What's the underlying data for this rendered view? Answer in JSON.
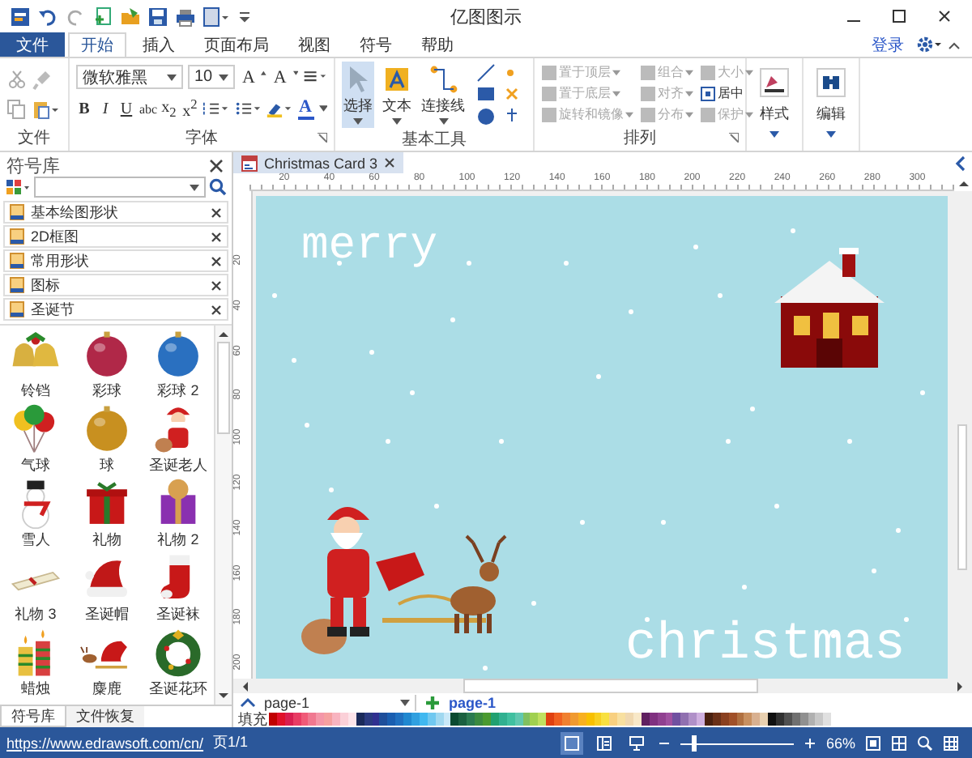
{
  "window": {
    "title": "亿图图示"
  },
  "ribbon_tabs": [
    {
      "label": "文件",
      "kind": "file",
      "selected": false
    },
    {
      "label": "开始",
      "kind": "tab",
      "selected": true
    },
    {
      "label": "插入",
      "kind": "tab",
      "selected": false
    },
    {
      "label": "页面布局",
      "kind": "tab",
      "selected": false
    },
    {
      "label": "视图",
      "kind": "tab",
      "selected": false
    },
    {
      "label": "符号",
      "kind": "tab",
      "selected": false
    },
    {
      "label": "帮助",
      "kind": "tab",
      "selected": false
    }
  ],
  "account": {
    "login": "登录"
  },
  "ribbon": {
    "file_group": {
      "label": "文件"
    },
    "font_group": {
      "label": "字体",
      "font": "微软雅黑",
      "size": "10",
      "grow": "A",
      "shrink": "A",
      "format_buttons": [
        {
          "label": "B",
          "kind": "bold"
        },
        {
          "label": "I",
          "kind": "italic"
        },
        {
          "label": "U",
          "kind": "underline"
        },
        {
          "label": "abc",
          "kind": "strike"
        },
        {
          "label": "x$_{2}$",
          "kind": "sub"
        },
        {
          "label": "x$^{2}$",
          "kind": "sup"
        }
      ],
      "font_color": "A"
    },
    "tools_group": {
      "label": "基本工具",
      "tools": [
        {
          "label": "选择",
          "kind": "select",
          "selected": true
        },
        {
          "label": "文本",
          "kind": "text",
          "selected": false
        },
        {
          "label": "连接线",
          "kind": "connector",
          "selected": false
        }
      ]
    },
    "arrange_group": {
      "label": "排列",
      "commands": [
        {
          "label": "置于顶层",
          "disabled": true,
          "dropdown": true
        },
        {
          "label": "置于底层",
          "disabled": true,
          "dropdown": true
        },
        {
          "label": "旋转和镜像",
          "disabled": true,
          "dropdown": true
        },
        {
          "label": "组合",
          "disabled": true,
          "dropdown": true
        },
        {
          "label": "对齐",
          "disabled": true,
          "dropdown": true
        },
        {
          "label": "分布",
          "disabled": true,
          "dropdown": true
        },
        {
          "label": "大小",
          "disabled": true,
          "dropdown": true
        },
        {
          "label": "居中",
          "disabled": false,
          "dropdown": false
        },
        {
          "label": "保护",
          "disabled": true,
          "dropdown": true
        }
      ]
    },
    "big_buttons": [
      {
        "label": "样式",
        "kind": "style"
      },
      {
        "label": "编辑",
        "kind": "edit"
      }
    ]
  },
  "library": {
    "title": "符号库",
    "categories": [
      {
        "label": "基本绘图形状"
      },
      {
        "label": "2D框图"
      },
      {
        "label": "常用形状"
      },
      {
        "label": "图标"
      },
      {
        "label": "圣诞节"
      }
    ],
    "shapes": [
      {
        "label": "铃铛",
        "kind": "bells"
      },
      {
        "label": "彩球",
        "kind": "ball",
        "color": "#b02848"
      },
      {
        "label": "彩球 2",
        "kind": "ball",
        "color": "#2a70c0"
      },
      {
        "label": "气球",
        "kind": "balloons"
      },
      {
        "label": "球",
        "kind": "ball",
        "color": "#c89020"
      },
      {
        "label": "圣诞老人",
        "kind": "santa"
      },
      {
        "label": "雪人",
        "kind": "snowman"
      },
      {
        "label": "礼物",
        "kind": "gift"
      },
      {
        "label": "礼物 2",
        "kind": "gift2"
      },
      {
        "label": "礼物 3",
        "kind": "gift3"
      },
      {
        "label": "圣诞帽",
        "kind": "hat"
      },
      {
        "label": "圣诞袜",
        "kind": "stocking"
      },
      {
        "label": "蜡烛",
        "kind": "candles"
      },
      {
        "label": "麋鹿",
        "kind": "sleigh"
      },
      {
        "label": "圣诞花环",
        "kind": "wreath"
      }
    ],
    "bottom_tabs": [
      {
        "label": "符号库",
        "selected": true
      },
      {
        "label": "文件恢复",
        "selected": false
      }
    ]
  },
  "document_tab": {
    "title": "Christmas Card 3",
    "selected": true
  },
  "ruler": {
    "h_labels": [
      "20",
      "40",
      "60",
      "80",
      "100",
      "120",
      "140",
      "160",
      "180",
      "200",
      "220",
      "240",
      "260",
      "280",
      "300"
    ],
    "v_labels": [
      "20",
      "40",
      "60",
      "80",
      "100",
      "120",
      "140",
      "160",
      "180",
      "200"
    ]
  },
  "card": {
    "texts": [
      {
        "text": "merry",
        "kind": "top"
      },
      {
        "text": "christmas",
        "kind": "bottom"
      }
    ]
  },
  "pages": {
    "selector": "page-1",
    "tabs": [
      {
        "label": "page-1",
        "selected": true
      }
    ]
  },
  "palette": {
    "label": "填充",
    "swatches": [
      {
        "color": "#c00000"
      },
      {
        "color": "#e0102a"
      },
      {
        "color": "#d81e50"
      },
      {
        "color": "#e83c64"
      },
      {
        "color": "#f05a78"
      },
      {
        "color": "#f07890"
      },
      {
        "color": "#f496a8"
      },
      {
        "color": "#f5a0a0"
      },
      {
        "color": "#f8b4c0"
      },
      {
        "color": "#fbd0d8"
      },
      {
        "color": "#fde4ea"
      },
      {
        "color": "#1a2a5a"
      },
      {
        "color": "#2a3a80"
      },
      {
        "color": "#303090"
      },
      {
        "color": "#1e4e9a"
      },
      {
        "color": "#1a5eb0"
      },
      {
        "color": "#2070c0"
      },
      {
        "color": "#2088d0"
      },
      {
        "color": "#30a0e0"
      },
      {
        "color": "#40b8f0"
      },
      {
        "color": "#70c8f0"
      },
      {
        "color": "#a0d8f0"
      },
      {
        "color": "#c8e8f8"
      },
      {
        "color": "#0a4a30"
      },
      {
        "color": "#1a6040"
      },
      {
        "color": "#2a7a50"
      },
      {
        "color": "#3a8a40"
      },
      {
        "color": "#4a9a30"
      },
      {
        "color": "#20a070"
      },
      {
        "color": "#30b090"
      },
      {
        "color": "#40c0a0"
      },
      {
        "color": "#60c8b0"
      },
      {
        "color": "#80c060"
      },
      {
        "color": "#a0d050"
      },
      {
        "color": "#c0e060"
      },
      {
        "color": "#e04010"
      },
      {
        "color": "#f06020"
      },
      {
        "color": "#f08030"
      },
      {
        "color": "#f09a30"
      },
      {
        "color": "#f8b020"
      },
      {
        "color": "#f8c000"
      },
      {
        "color": "#f8d020"
      },
      {
        "color": "#f8e040"
      },
      {
        "color": "#f8d080"
      },
      {
        "color": "#f8e0a0"
      },
      {
        "color": "#f0d8b0"
      },
      {
        "color": "#f8e8c8"
      },
      {
        "color": "#602060"
      },
      {
        "color": "#803080"
      },
      {
        "color": "#904090"
      },
      {
        "color": "#a050a0"
      },
      {
        "color": "#7050a0"
      },
      {
        "color": "#9070b0"
      },
      {
        "color": "#b090c8"
      },
      {
        "color": "#d0b0e0"
      },
      {
        "color": "#4a2010"
      },
      {
        "color": "#6a3018"
      },
      {
        "color": "#8a4020"
      },
      {
        "color": "#a05028"
      },
      {
        "color": "#b07040"
      },
      {
        "color": "#c89060"
      },
      {
        "color": "#d8b090"
      },
      {
        "color": "#e8d0b0"
      },
      {
        "color": "#101010"
      },
      {
        "color": "#303030"
      },
      {
        "color": "#505050"
      },
      {
        "color": "#707070"
      },
      {
        "color": "#909090"
      },
      {
        "color": "#b0b0b0"
      },
      {
        "color": "#c8c8c8"
      },
      {
        "color": "#e0e0e0"
      }
    ]
  },
  "status_bar": {
    "link": "https://www.edrawsoft.com/cn/",
    "page": "页1/1",
    "views": [
      {
        "kind": "normal",
        "selected": true
      },
      {
        "kind": "outline",
        "selected": false
      },
      {
        "kind": "present",
        "selected": false
      }
    ],
    "zoom": {
      "level": 0.12
    },
    "zoom_text": "66%"
  }
}
